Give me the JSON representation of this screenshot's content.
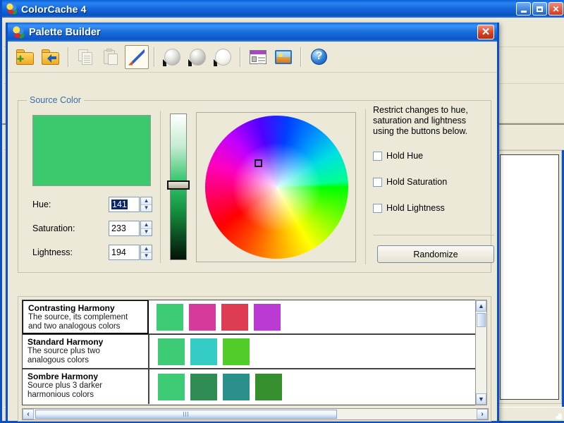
{
  "app_window": {
    "title": "ColorCache 4",
    "icon": "colorcache-logo-icon",
    "buttons": {
      "minimize": "_",
      "maximize": "□",
      "close": "✕"
    }
  },
  "dialog": {
    "title": "Palette Builder",
    "icon": "colorcache-logo-icon",
    "close_label": "✕",
    "toolbar": [
      {
        "name": "new-palette-button",
        "icon": "folder-add-icon",
        "state": "enabled"
      },
      {
        "name": "open-palette-button",
        "icon": "folder-open-icon",
        "state": "enabled"
      },
      {
        "name": "copy-button",
        "icon": "copy-icon",
        "state": "disabled"
      },
      {
        "name": "paste-button",
        "icon": "paste-icon",
        "state": "disabled"
      },
      {
        "name": "eyedropper-button",
        "icon": "eyedropper-icon",
        "state": "pressed"
      },
      {
        "name": "sphere-shading-1-button",
        "icon": "sphere-matte-icon",
        "state": "enabled"
      },
      {
        "name": "sphere-shading-2-button",
        "icon": "sphere-gradient-icon",
        "state": "enabled"
      },
      {
        "name": "sphere-shading-3-button",
        "icon": "sphere-light-icon",
        "state": "enabled"
      },
      {
        "name": "view-details-button",
        "icon": "window-list-icon",
        "state": "enabled"
      },
      {
        "name": "view-image-button",
        "icon": "image-preview-icon",
        "state": "enabled"
      },
      {
        "name": "help-button",
        "icon": "help-question-icon",
        "state": "enabled"
      }
    ],
    "source_color": {
      "legend": "Source Color",
      "preview_color": "#3cc96e",
      "fields": [
        {
          "label": "Hue:",
          "value": "141",
          "selected": true
        },
        {
          "label": "Saturation:",
          "value": "233",
          "selected": false
        },
        {
          "label": "Lightness:",
          "value": "194",
          "selected": false
        }
      ],
      "slider": {
        "name": "lightness-slider",
        "position_percent": 48
      },
      "wheel": {
        "name": "color-wheel",
        "marker_x_percent": 36,
        "marker_y_percent": 32
      }
    },
    "restrict": {
      "description": "Restrict changes to hue,\nsaturation and lightness\nusing the buttons below.",
      "checkboxes": [
        {
          "label": "Hold Hue",
          "checked": false
        },
        {
          "label": "Hold Saturation",
          "checked": false
        },
        {
          "label": "Hold Lightness",
          "checked": false
        }
      ],
      "randomize_label": "Randomize"
    },
    "harmonies": [
      {
        "title": "Contrasting Harmony",
        "description": "The source, its complement\nand two analogous colors",
        "selected": true,
        "swatches": [
          "#3ecb76",
          "#d63a9a",
          "#dd3c51",
          "#bb3ad4"
        ]
      },
      {
        "title": "Standard Harmony",
        "description": "The source plus two\nanalogous colors",
        "selected": false,
        "swatches": [
          "#3ecb76",
          "#34ccc4",
          "#52cc28"
        ]
      },
      {
        "title": "Sombre Harmony",
        "description": "Source plus 3 darker\nharmonious colors",
        "selected": false,
        "swatches": [
          "#3ecb76",
          "#2f8c52",
          "#2b8f8c",
          "#358f2c"
        ]
      }
    ],
    "scrollbars": {
      "vertical": {
        "up": "▲",
        "down": "▼"
      },
      "horizontal": {
        "left": "‹",
        "right": "›"
      }
    }
  }
}
